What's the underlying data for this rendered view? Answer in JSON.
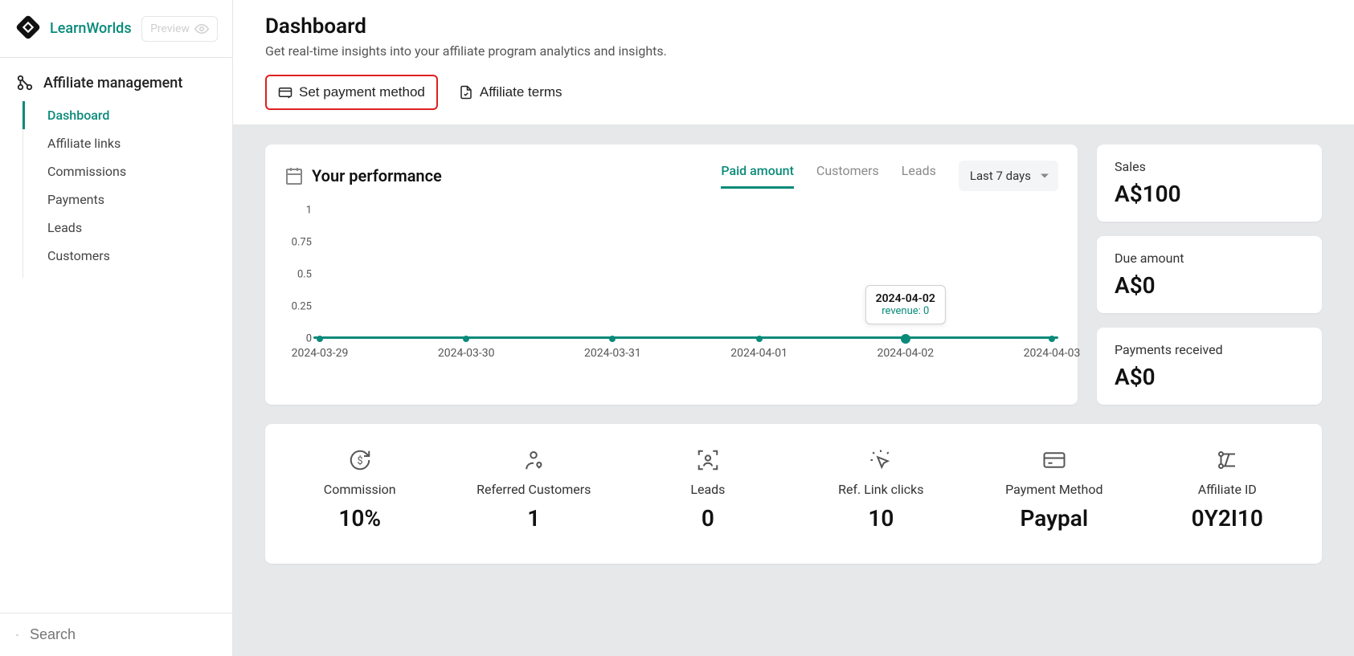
{
  "brand": {
    "name": "LearnWorlds",
    "preview_label": "Preview"
  },
  "section": {
    "title": "Affiliate management"
  },
  "nav": {
    "items": [
      {
        "label": "Dashboard",
        "active": true
      },
      {
        "label": "Affiliate links"
      },
      {
        "label": "Commissions"
      },
      {
        "label": "Payments"
      },
      {
        "label": "Leads"
      },
      {
        "label": "Customers"
      }
    ]
  },
  "search": {
    "placeholder": "Search"
  },
  "header": {
    "title": "Dashboard",
    "subtitle": "Get real-time insights into your affiliate program analytics and insights."
  },
  "tabs": {
    "set_payment_method": "Set payment method",
    "affiliate_terms": "Affiliate terms"
  },
  "performance": {
    "title": "Your performance",
    "metrics": {
      "paid_amount": "Paid amount",
      "customers": "Customers",
      "leads": "Leads"
    },
    "range_selected": "Last 7 days"
  },
  "chart_data": {
    "type": "line",
    "title": "Your performance",
    "xlabel": "",
    "ylabel": "",
    "ylim": [
      0,
      1
    ],
    "yticks": [
      0,
      0.25,
      0.5,
      0.75,
      1
    ],
    "categories": [
      "2024-03-29",
      "2024-03-30",
      "2024-03-31",
      "2024-04-01",
      "2024-04-02",
      "2024-04-03"
    ],
    "series": [
      {
        "name": "revenue",
        "values": [
          0,
          0,
          0,
          0,
          0,
          0
        ]
      }
    ],
    "tooltip": {
      "date": "2024-04-02",
      "metric_label": "revenue:",
      "value": "0",
      "category_index": 4
    }
  },
  "side_stats": {
    "sales": {
      "label": "Sales",
      "value": "A$100"
    },
    "due": {
      "label": "Due amount",
      "value": "A$0"
    },
    "payments_received": {
      "label": "Payments received",
      "value": "A$0"
    }
  },
  "summary": {
    "commission": {
      "label": "Commission",
      "value": "10%"
    },
    "referred_customers": {
      "label": "Referred Customers",
      "value": "1"
    },
    "leads": {
      "label": "Leads",
      "value": "0"
    },
    "ref_link_clicks": {
      "label": "Ref. Link clicks",
      "value": "10"
    },
    "payment_method": {
      "label": "Payment Method",
      "value": "Paypal"
    },
    "affiliate_id": {
      "label": "Affiliate ID",
      "value": "0Y2I10"
    }
  }
}
